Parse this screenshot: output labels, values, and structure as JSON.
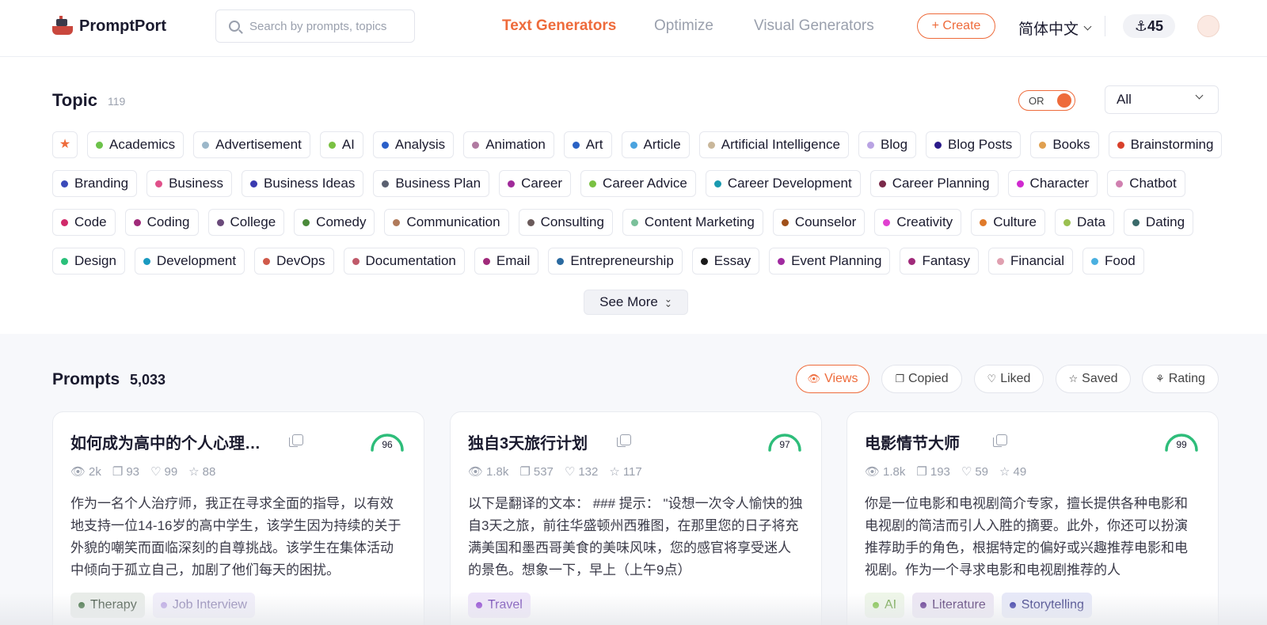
{
  "header": {
    "brand": "PromptPort",
    "search_placeholder": "Search by prompts, topics",
    "tabs": [
      {
        "label": "Text Generators",
        "active": true
      },
      {
        "label": "Optimize",
        "active": false
      },
      {
        "label": "Visual Generators",
        "active": false
      }
    ],
    "create_label": "+ Create",
    "language": "简体中文",
    "points": "⚓45"
  },
  "topic": {
    "title": "Topic",
    "count": "119",
    "toggle_label": "OR",
    "filter_value": "All",
    "see_more": "See More",
    "rows": [
      [
        {
          "label": "Academics",
          "color": "#6cc24a"
        },
        {
          "label": "Advertisement",
          "color": "#9bb7c9"
        },
        {
          "label": "AI",
          "color": "#7ac142"
        },
        {
          "label": "Analysis",
          "color": "#2a5fc9"
        },
        {
          "label": "Animation",
          "color": "#b07aa1"
        },
        {
          "label": "Art",
          "color": "#2a62c4"
        },
        {
          "label": "Article",
          "color": "#4aa3df"
        },
        {
          "label": "Artificial Intelligence",
          "color": "#c9b79a"
        },
        {
          "label": "Blog",
          "color": "#b9a3e3"
        },
        {
          "label": "Blog Posts",
          "color": "#2a1a8a"
        },
        {
          "label": "Books",
          "color": "#e0a050"
        },
        {
          "label": "Brainstorming",
          "color": "#d8402a"
        }
      ],
      [
        {
          "label": "Branding",
          "color": "#3a4ab9"
        },
        {
          "label": "Business",
          "color": "#e0508a"
        },
        {
          "label": "Business Ideas",
          "color": "#3a3ab0"
        },
        {
          "label": "Business Plan",
          "color": "#5a6070"
        },
        {
          "label": "Career",
          "color": "#a02a9a"
        },
        {
          "label": "Career Advice",
          "color": "#7ac142"
        },
        {
          "label": "Career Development",
          "color": "#1a9ab0"
        },
        {
          "label": "Career Planning",
          "color": "#7a2a4a"
        },
        {
          "label": "Character",
          "color": "#d02ad0"
        },
        {
          "label": "Chatbot",
          "color": "#d080b0"
        }
      ],
      [
        {
          "label": "Code",
          "color": "#d02a6a"
        },
        {
          "label": "Coding",
          "color": "#a02a7a"
        },
        {
          "label": "College",
          "color": "#6a4a7a"
        },
        {
          "label": "Comedy",
          "color": "#4a8a3a"
        },
        {
          "label": "Communication",
          "color": "#b07a5a"
        },
        {
          "label": "Consulting",
          "color": "#6a5a5a"
        },
        {
          "label": "Content Marketing",
          "color": "#7ac09a"
        },
        {
          "label": "Counselor",
          "color": "#a0501a"
        },
        {
          "label": "Creativity",
          "color": "#e040d0"
        },
        {
          "label": "Culture",
          "color": "#e07a2a"
        },
        {
          "label": "Data",
          "color": "#9ac050"
        },
        {
          "label": "Dating",
          "color": "#3a6a6a"
        }
      ],
      [
        {
          "label": "Design",
          "color": "#2ac07a"
        },
        {
          "label": "Development",
          "color": "#1a9ac0"
        },
        {
          "label": "DevOps",
          "color": "#d05a4a"
        },
        {
          "label": "Documentation",
          "color": "#c05a6a"
        },
        {
          "label": "Email",
          "color": "#a02a7a"
        },
        {
          "label": "Entrepreneurship",
          "color": "#2a6aa0"
        },
        {
          "label": "Essay",
          "color": "#1a1a1a"
        },
        {
          "label": "Event Planning",
          "color": "#a02aa0"
        },
        {
          "label": "Fantasy",
          "color": "#a02a7a"
        },
        {
          "label": "Financial",
          "color": "#e0a0b0"
        },
        {
          "label": "Food",
          "color": "#4ab0e0"
        }
      ]
    ]
  },
  "prompts": {
    "title": "Prompts",
    "count": "5,033",
    "sort": [
      {
        "label": "Views",
        "icon": "👁",
        "active": true
      },
      {
        "label": "Copied",
        "icon": "❐",
        "active": false
      },
      {
        "label": "Liked",
        "icon": "♡",
        "active": false
      },
      {
        "label": "Saved",
        "icon": "☆",
        "active": false
      },
      {
        "label": "Rating",
        "icon": "⚘",
        "active": false
      }
    ],
    "cards": [
      {
        "title": "如何成为高中的个人心理治疗师",
        "score": 96,
        "views": "2k",
        "copied": "93",
        "liked": "99",
        "saved": "88",
        "desc": "作为一名个人治疗师，我正在寻求全面的指导，以有效地支持一位14-16岁的高中学生，该学生因为持续的关于外貌的嘲笑而面临深刻的自尊挑战。该学生在集体活动中倾向于孤立自己，加剧了他们每天的困扰。",
        "tags": [
          {
            "label": "Therapy",
            "dot": "#3a6a3a",
            "bg": "#e8ece8",
            "fg": "#3a4a3a"
          },
          {
            "label": "Job Interview",
            "dot": "#b9a3e3",
            "bg": "#f1eefa",
            "fg": "#8a80b0"
          }
        ]
      },
      {
        "title": "独自3天旅行计划",
        "score": 97,
        "views": "1.8k",
        "copied": "537",
        "liked": "132",
        "saved": "117",
        "desc": "以下是翻译的文本： ### 提示： \"设想一次令人愉快的独自3天之旅，前往华盛顿州西雅图，在那里您的日子将充满美国和墨西哥美食的美味风味，您的感官将享受迷人的景色。想象一下，早上（上午9点）",
        "tags": [
          {
            "label": "Travel",
            "dot": "#8a3ad0",
            "bg": "#efe6fa",
            "fg": "#6a3ab0"
          }
        ]
      },
      {
        "title": "电影情节大师",
        "score": 99,
        "views": "1.8k",
        "copied": "193",
        "liked": "59",
        "saved": "49",
        "desc": "你是一位电影和电视剧简介专家，擅长提供各种电影和电视剧的简洁而引人入胜的摘要。此外，你还可以扮演推荐助手的角色，根据特定的偏好或兴趣推荐电影和电视剧。作为一个寻求电影和电视剧推荐的人",
        "tags": [
          {
            "label": "AI",
            "dot": "#7ac142",
            "bg": "#eef6e8",
            "fg": "#6aa040"
          },
          {
            "label": "Literature",
            "dot": "#5a2a8a",
            "bg": "#ece6f4",
            "fg": "#4a2a6a"
          },
          {
            "label": "Storytelling",
            "dot": "#2a2aa0",
            "bg": "#e6e8f8",
            "fg": "#2a2a7a"
          }
        ]
      }
    ]
  }
}
